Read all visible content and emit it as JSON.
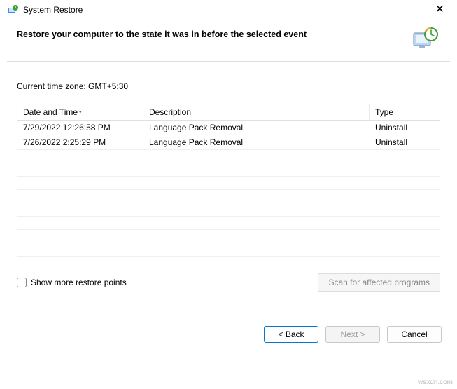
{
  "titlebar": {
    "title": "System Restore"
  },
  "header": {
    "heading": "Restore your computer to the state it was in before the selected event"
  },
  "timezone": {
    "label": "Current time zone: GMT+5:30"
  },
  "table": {
    "columns": {
      "datetime": "Date and Time",
      "desc": "Description",
      "type": "Type"
    },
    "rows": [
      {
        "datetime": "7/29/2022 12:26:58 PM",
        "desc": "Language Pack Removal",
        "type": "Uninstall"
      },
      {
        "datetime": "7/26/2022 2:25:29 PM",
        "desc": "Language Pack Removal",
        "type": "Uninstall"
      }
    ]
  },
  "options": {
    "show_more": "Show more restore points",
    "scan": "Scan for affected programs"
  },
  "buttons": {
    "back": "< Back",
    "next": "Next >",
    "cancel": "Cancel"
  },
  "watermark": "wsxdn.com"
}
